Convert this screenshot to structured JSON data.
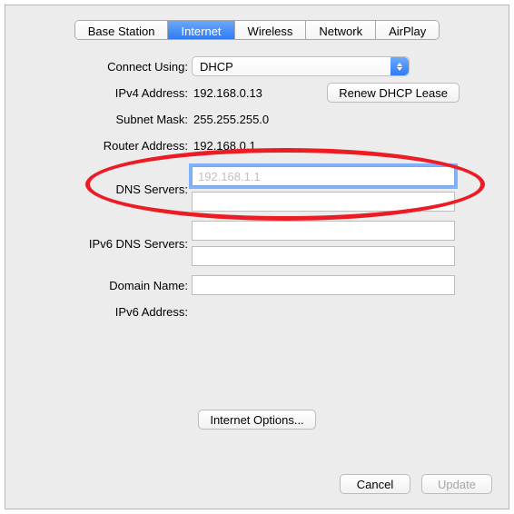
{
  "tabs": {
    "base_station": "Base Station",
    "internet": "Internet",
    "wireless": "Wireless",
    "network": "Network",
    "airplay": "AirPlay"
  },
  "form": {
    "connect_using_label": "Connect Using:",
    "connect_using_value": "DHCP",
    "ipv4_address_label": "IPv4 Address:",
    "ipv4_address_value": "192.168.0.13",
    "renew_dhcp": "Renew DHCP Lease",
    "subnet_mask_label": "Subnet Mask:",
    "subnet_mask_value": "255.255.255.0",
    "router_address_label": "Router Address:",
    "router_address_value": "192.168.0.1",
    "dns_servers_label": "DNS Servers:",
    "dns_servers_placeholder": "192.168.1.1",
    "ipv6_dns_servers_label": "IPv6 DNS Servers:",
    "domain_name_label": "Domain Name:",
    "ipv6_address_label": "IPv6 Address:"
  },
  "internet_options": "Internet Options...",
  "buttons": {
    "cancel": "Cancel",
    "update": "Update"
  }
}
